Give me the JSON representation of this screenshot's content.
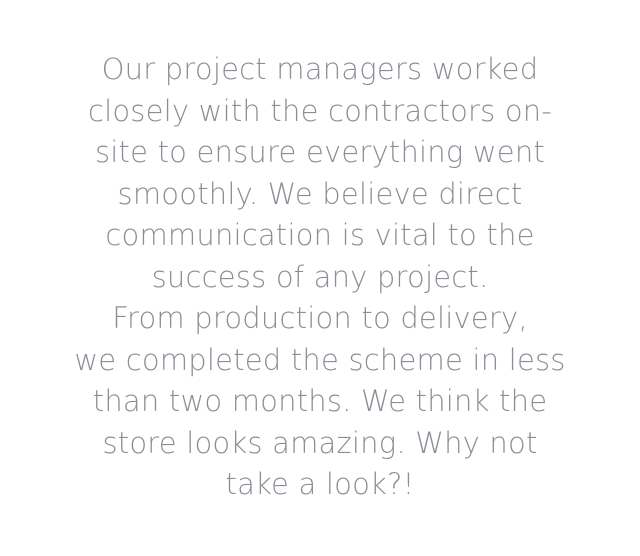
{
  "lines": [
    "Our project managers worked",
    "closely with the contractors on-",
    "site to ensure everything went",
    "smoothly. We believe direct",
    "communication is vital to the",
    "success of any project.",
    "From production to delivery,",
    "we completed the scheme in less",
    "than two months. We think the",
    "store looks amazing. Why not",
    "take a look?!"
  ],
  "colors": {
    "text": "#8a8f96",
    "background": "#ffffff"
  }
}
